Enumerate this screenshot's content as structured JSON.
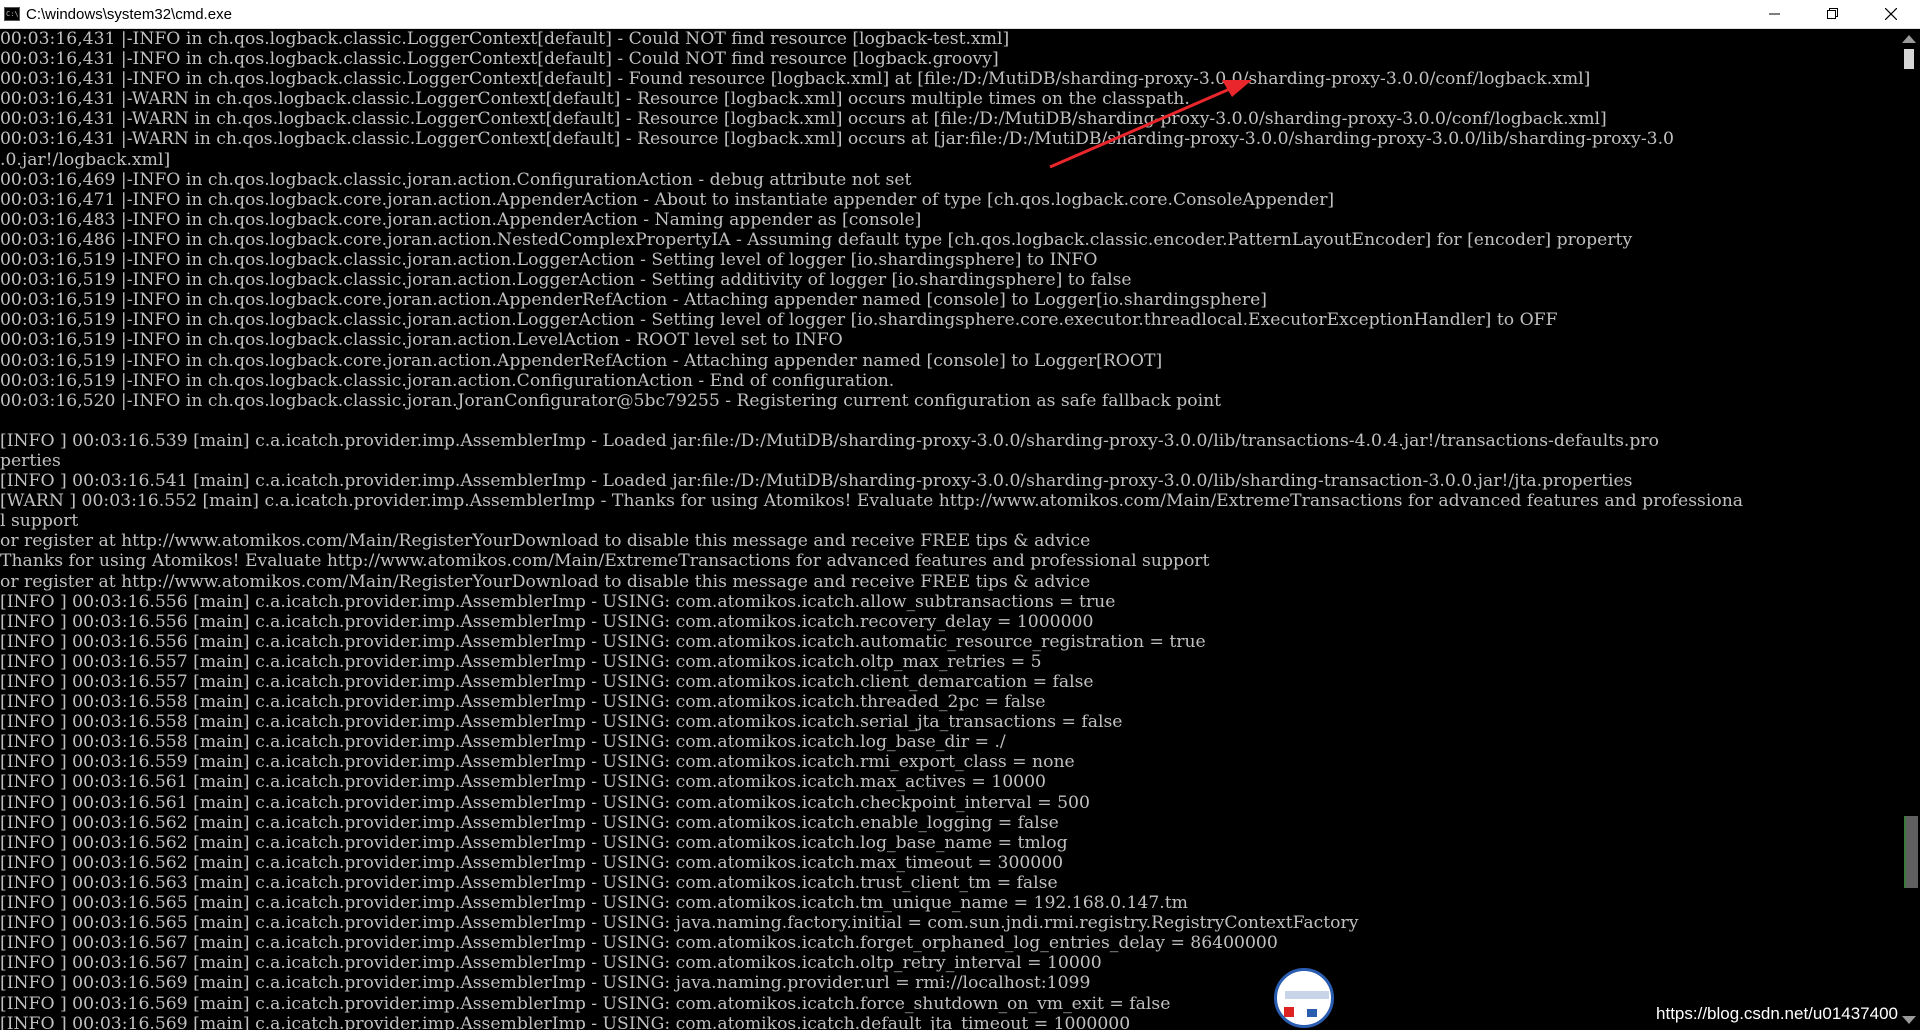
{
  "window": {
    "title": "C:\\windows\\system32\\cmd.exe",
    "minimize_label": "minimize",
    "restore_label": "restore",
    "close_label": "close"
  },
  "console": {
    "lines": [
      "00:03:16,431 |-INFO in ch.qos.logback.classic.LoggerContext[default] - Could NOT find resource [logback-test.xml]",
      "00:03:16,431 |-INFO in ch.qos.logback.classic.LoggerContext[default] - Could NOT find resource [logback.groovy]",
      "00:03:16,431 |-INFO in ch.qos.logback.classic.LoggerContext[default] - Found resource [logback.xml] at [file:/D:/MutiDB/sharding-proxy-3.0.0/sharding-proxy-3.0.0/conf/logback.xml]",
      "00:03:16,431 |-WARN in ch.qos.logback.classic.LoggerContext[default] - Resource [logback.xml] occurs multiple times on the classpath.",
      "00:03:16,431 |-WARN in ch.qos.logback.classic.LoggerContext[default] - Resource [logback.xml] occurs at [file:/D:/MutiDB/sharding-proxy-3.0.0/sharding-proxy-3.0.0/conf/logback.xml]",
      "00:03:16,431 |-WARN in ch.qos.logback.classic.LoggerContext[default] - Resource [logback.xml] occurs at [jar:file:/D:/MutiDB/sharding-proxy-3.0.0/sharding-proxy-3.0.0/lib/sharding-proxy-3.0",
      ".0.jar!/logback.xml]",
      "00:03:16,469 |-INFO in ch.qos.logback.classic.joran.action.ConfigurationAction - debug attribute not set",
      "00:03:16,471 |-INFO in ch.qos.logback.core.joran.action.AppenderAction - About to instantiate appender of type [ch.qos.logback.core.ConsoleAppender]",
      "00:03:16,483 |-INFO in ch.qos.logback.core.joran.action.AppenderAction - Naming appender as [console]",
      "00:03:16,486 |-INFO in ch.qos.logback.core.joran.action.NestedComplexPropertyIA - Assuming default type [ch.qos.logback.classic.encoder.PatternLayoutEncoder] for [encoder] property",
      "00:03:16,519 |-INFO in ch.qos.logback.classic.joran.action.LoggerAction - Setting level of logger [io.shardingsphere] to INFO",
      "00:03:16,519 |-INFO in ch.qos.logback.classic.joran.action.LoggerAction - Setting additivity of logger [io.shardingsphere] to false",
      "00:03:16,519 |-INFO in ch.qos.logback.core.joran.action.AppenderRefAction - Attaching appender named [console] to Logger[io.shardingsphere]",
      "00:03:16,519 |-INFO in ch.qos.logback.classic.joran.action.LoggerAction - Setting level of logger [io.shardingsphere.core.executor.threadlocal.ExecutorExceptionHandler] to OFF",
      "00:03:16,519 |-INFO in ch.qos.logback.classic.joran.action.LevelAction - ROOT level set to INFO",
      "00:03:16,519 |-INFO in ch.qos.logback.core.joran.action.AppenderRefAction - Attaching appender named [console] to Logger[ROOT]",
      "00:03:16,519 |-INFO in ch.qos.logback.classic.joran.action.ConfigurationAction - End of configuration.",
      "00:03:16,520 |-INFO in ch.qos.logback.classic.joran.JoranConfigurator@5bc79255 - Registering current configuration as safe fallback point",
      "",
      "[INFO ] 00:03:16.539 [main] c.a.icatch.provider.imp.AssemblerImp - Loaded jar:file:/D:/MutiDB/sharding-proxy-3.0.0/sharding-proxy-3.0.0/lib/transactions-4.0.4.jar!/transactions-defaults.pro",
      "perties",
      "[INFO ] 00:03:16.541 [main] c.a.icatch.provider.imp.AssemblerImp - Loaded jar:file:/D:/MutiDB/sharding-proxy-3.0.0/sharding-proxy-3.0.0/lib/sharding-transaction-3.0.0.jar!/jta.properties",
      "[WARN ] 00:03:16.552 [main] c.a.icatch.provider.imp.AssemblerImp - Thanks for using Atomikos! Evaluate http://www.atomikos.com/Main/ExtremeTransactions for advanced features and professiona",
      "l support",
      "or register at http://www.atomikos.com/Main/RegisterYourDownload to disable this message and receive FREE tips & advice",
      "Thanks for using Atomikos! Evaluate http://www.atomikos.com/Main/ExtremeTransactions for advanced features and professional support",
      "or register at http://www.atomikos.com/Main/RegisterYourDownload to disable this message and receive FREE tips & advice",
      "[INFO ] 00:03:16.556 [main] c.a.icatch.provider.imp.AssemblerImp - USING: com.atomikos.icatch.allow_subtransactions = true",
      "[INFO ] 00:03:16.556 [main] c.a.icatch.provider.imp.AssemblerImp - USING: com.atomikos.icatch.recovery_delay = 1000000",
      "[INFO ] 00:03:16.556 [main] c.a.icatch.provider.imp.AssemblerImp - USING: com.atomikos.icatch.automatic_resource_registration = true",
      "[INFO ] 00:03:16.557 [main] c.a.icatch.provider.imp.AssemblerImp - USING: com.atomikos.icatch.oltp_max_retries = 5",
      "[INFO ] 00:03:16.557 [main] c.a.icatch.provider.imp.AssemblerImp - USING: com.atomikos.icatch.client_demarcation = false",
      "[INFO ] 00:03:16.558 [main] c.a.icatch.provider.imp.AssemblerImp - USING: com.atomikos.icatch.threaded_2pc = false",
      "[INFO ] 00:03:16.558 [main] c.a.icatch.provider.imp.AssemblerImp - USING: com.atomikos.icatch.serial_jta_transactions = false",
      "[INFO ] 00:03:16.558 [main] c.a.icatch.provider.imp.AssemblerImp - USING: com.atomikos.icatch.log_base_dir = ./",
      "[INFO ] 00:03:16.559 [main] c.a.icatch.provider.imp.AssemblerImp - USING: com.atomikos.icatch.rmi_export_class = none",
      "[INFO ] 00:03:16.561 [main] c.a.icatch.provider.imp.AssemblerImp - USING: com.atomikos.icatch.max_actives = 10000",
      "[INFO ] 00:03:16.561 [main] c.a.icatch.provider.imp.AssemblerImp - USING: com.atomikos.icatch.checkpoint_interval = 500",
      "[INFO ] 00:03:16.562 [main] c.a.icatch.provider.imp.AssemblerImp - USING: com.atomikos.icatch.enable_logging = false",
      "[INFO ] 00:03:16.562 [main] c.a.icatch.provider.imp.AssemblerImp - USING: com.atomikos.icatch.log_base_name = tmlog",
      "[INFO ] 00:03:16.562 [main] c.a.icatch.provider.imp.AssemblerImp - USING: com.atomikos.icatch.max_timeout = 300000",
      "[INFO ] 00:03:16.563 [main] c.a.icatch.provider.imp.AssemblerImp - USING: com.atomikos.icatch.trust_client_tm = false",
      "[INFO ] 00:03:16.565 [main] c.a.icatch.provider.imp.AssemblerImp - USING: com.atomikos.icatch.tm_unique_name = 192.168.0.147.tm",
      "[INFO ] 00:03:16.565 [main] c.a.icatch.provider.imp.AssemblerImp - USING: java.naming.factory.initial = com.sun.jndi.rmi.registry.RegistryContextFactory",
      "[INFO ] 00:03:16.567 [main] c.a.icatch.provider.imp.AssemblerImp - USING: com.atomikos.icatch.forget_orphaned_log_entries_delay = 86400000",
      "[INFO ] 00:03:16.567 [main] c.a.icatch.provider.imp.AssemblerImp - USING: com.atomikos.icatch.oltp_retry_interval = 10000",
      "[INFO ] 00:03:16.569 [main] c.a.icatch.provider.imp.AssemblerImp - USING: java.naming.provider.url = rmi://localhost:1099",
      "[INFO ] 00:03:16.569 [main] c.a.icatch.provider.imp.AssemblerImp - USING: com.atomikos.icatch.force_shutdown_on_vm_exit = false",
      "[INFO ] 00:03:16.569 [main] c.a.icatch.provider.imp.AssemblerImp - USING: com.atomikos.icatch.default_jta_timeout = 1000000"
    ]
  },
  "watermark": "https://blog.csdn.net/u01437400",
  "colors": {
    "console_bg": "#000000",
    "console_fg": "#c0c0c0",
    "titlebar_bg": "#ffffff",
    "arrow": "#e8262b"
  }
}
